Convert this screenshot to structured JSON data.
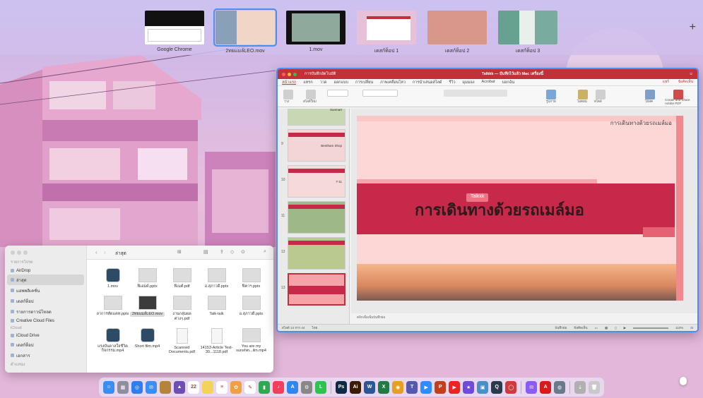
{
  "spaces": [
    {
      "label": "Google Chrome"
    },
    {
      "label": "2ทยแมล์LEO.mov",
      "active": true
    },
    {
      "label": "1.mov"
    },
    {
      "label": "เดสก์ท็อป 1"
    },
    {
      "label": "เดสก์ท็อป 2"
    },
    {
      "label": "เดสก์ท็อป 3"
    }
  ],
  "add_space_label": "+",
  "finder": {
    "path_title": "ล่าสุด",
    "sidebar": [
      {
        "type": "section",
        "label": "รายการโปรด"
      },
      {
        "type": "item",
        "label": "AirDrop"
      },
      {
        "type": "item",
        "label": "ล่าสุด",
        "selected": true
      },
      {
        "type": "item",
        "label": "แอพพลิเคชั่น"
      },
      {
        "type": "item",
        "label": "เดสก์ท็อป"
      },
      {
        "type": "item",
        "label": "รายการดาวน์โหลด"
      },
      {
        "type": "item",
        "label": "Creative Cloud Files"
      },
      {
        "type": "section",
        "label": "iCloud"
      },
      {
        "type": "item",
        "label": "iCloud Drive"
      },
      {
        "type": "item",
        "label": "เดสก์ท็อป"
      },
      {
        "type": "item",
        "label": "เอกสาร"
      },
      {
        "type": "section",
        "label": "ตำแหน่ง"
      },
      {
        "type": "item",
        "label": "เครือข่าย"
      }
    ],
    "files": [
      {
        "name": "1.mov",
        "kind": "video"
      },
      {
        "name": "ฟิเอมด์.pptx",
        "kind": "slide"
      },
      {
        "name": "ฟิเมต์.pdf",
        "kind": "slide"
      },
      {
        "name": "อ.สุภาวดี.pptx",
        "kind": "slide"
      },
      {
        "name": "ฟิคาฯ.pptx",
        "kind": "slide"
      },
      {
        "name": "ลาการทัดแคท.pptx",
        "kind": "slide"
      },
      {
        "name": "2ทยแมล์LEO.mov",
        "kind": "video-thumb",
        "selected": true
      },
      {
        "name": "งานกลุ่มผล ต่างๆ.pdf",
        "kind": "slide"
      },
      {
        "name": "Talk-talk",
        "kind": "slide"
      },
      {
        "name": "อ.สุภาวดี.pptx",
        "kind": "slide"
      },
      {
        "name": "แรงบันดาลใจชีวิต กิจกรรม.mp4",
        "kind": "video"
      },
      {
        "name": "Short film.mp4",
        "kind": "video"
      },
      {
        "name": "Scanned Documents.pdf",
        "kind": "doc"
      },
      {
        "name": "14153-Article Text-30...1118.pdf",
        "kind": "doc"
      },
      {
        "name": "You are my sunshin...ilm.mp4",
        "kind": "slide"
      }
    ]
  },
  "ppt": {
    "window_title": "Talkkk — บันทึกไว้แล้ว Mac เครื่องนี้",
    "autosave_label": "การบันทึกอัตโนมัติ",
    "tabs": [
      "หน้าแรก",
      "แทรก",
      "วาด",
      "ออกแบบ",
      "การเปลี่ยน",
      "ภาพเคลื่อนไหว",
      "การนำเสนอสไลด์",
      "รีวิว",
      "มุมมอง",
      "Acrobat",
      "บอกฉัน"
    ],
    "share_label": "แชร์",
    "comment_label": "ข้อคิดเห็น",
    "ribbon_labels": [
      "วาง",
      "สไลด์ใหม่",
      "รูปภาพ",
      "ไอคอน",
      "สไตล์",
      "ไม้สค",
      "Create and Share Adobe PDF"
    ],
    "thumbnails": [
      {
        "num": "",
        "caption": "Sunmart"
      },
      {
        "num": "9",
        "caption": "Bentham Shop"
      },
      {
        "num": "10",
        "caption": "7-11"
      },
      {
        "num": "11",
        "caption": ""
      },
      {
        "num": "12",
        "caption": ""
      },
      {
        "num": "13",
        "caption": "",
        "selected": true
      }
    ],
    "slide": {
      "corner_title": "การเดินทางด้วยรถเมล์มอ",
      "main_title": "การเดินทางด้วยรถเมล์มอ",
      "tag_label": "Talkkk"
    },
    "notes_placeholder": "คลิกเพื่อเพิ่มบันทึกย่อ",
    "status": {
      "slide_count": "สไลด์ 13 จาก 44",
      "language": "ไทย",
      "notes": "บันทึกย่อ",
      "comments": "ข้อคิดเห็น",
      "zoom": "110%"
    },
    "colors": {
      "accent": "#c2303a",
      "slide_band": "#c7294a"
    }
  },
  "dock": {
    "apps": [
      {
        "name": "finder",
        "color": "#3b8df0",
        "glyph": "☺"
      },
      {
        "name": "launchpad",
        "color": "#8e8e9e",
        "glyph": "▦"
      },
      {
        "name": "safari",
        "color": "#2f7ef0",
        "glyph": "◎"
      },
      {
        "name": "mail",
        "color": "#3a8ef5",
        "glyph": "✉"
      },
      {
        "name": "notes-app",
        "color": "#b5843c",
        "glyph": ""
      },
      {
        "name": "photos-app",
        "color": "#6d4fb3",
        "glyph": "▲"
      },
      {
        "name": "calendar",
        "color": "#ffffff",
        "glyph": "22"
      },
      {
        "name": "notes",
        "color": "#f4d35a",
        "glyph": ""
      },
      {
        "name": "reminders",
        "color": "#ffffff",
        "glyph": "≡"
      },
      {
        "name": "photos",
        "color": "#f0a040",
        "glyph": "✿"
      },
      {
        "name": "freeform",
        "color": "#ffffff",
        "glyph": "✎"
      },
      {
        "name": "numbers",
        "color": "#2fa84f",
        "glyph": "▮"
      },
      {
        "name": "music",
        "color": "#f33d5a",
        "glyph": "♪"
      },
      {
        "name": "app-store",
        "color": "#2f86f0",
        "glyph": "A"
      },
      {
        "name": "settings",
        "color": "#888888",
        "glyph": "⚙"
      },
      {
        "name": "line",
        "color": "#2ec24f",
        "glyph": "L"
      },
      {
        "name": "sep",
        "color": "",
        "glyph": ""
      },
      {
        "name": "photoshop",
        "color": "#0f2a44",
        "glyph": "Ps"
      },
      {
        "name": "illustrator",
        "color": "#3a1c00",
        "glyph": "Ai"
      },
      {
        "name": "word",
        "color": "#2b5797",
        "glyph": "W"
      },
      {
        "name": "excel",
        "color": "#1f7a43",
        "glyph": "X"
      },
      {
        "name": "chrome",
        "color": "#e6a020",
        "glyph": "◉"
      },
      {
        "name": "teams",
        "color": "#5558af",
        "glyph": "T"
      },
      {
        "name": "zoom",
        "color": "#2d8cff",
        "glyph": "▶"
      },
      {
        "name": "powerpoint",
        "color": "#c43e1c",
        "glyph": "P"
      },
      {
        "name": "youtube-app",
        "color": "#e22",
        "glyph": "▶"
      },
      {
        "name": "imovie",
        "color": "#6e4bd8",
        "glyph": "★"
      },
      {
        "name": "preview",
        "color": "#4a90c8",
        "glyph": "▣"
      },
      {
        "name": "quicktime",
        "color": "#2a3a4a",
        "glyph": "Q"
      },
      {
        "name": "photo-booth",
        "color": "#d13a3a",
        "glyph": "◯"
      },
      {
        "name": "sep",
        "color": "",
        "glyph": ""
      },
      {
        "name": "messenger",
        "color": "#8a5cf5",
        "glyph": "✉"
      },
      {
        "name": "acrobat",
        "color": "#d71b1b",
        "glyph": "A"
      },
      {
        "name": "disk-utility",
        "color": "#6a7a8a",
        "glyph": "◍"
      },
      {
        "name": "sep",
        "color": "",
        "glyph": ""
      },
      {
        "name": "downloads-stack",
        "color": "#b0b0b0",
        "glyph": "⇣"
      },
      {
        "name": "trash",
        "color": "#c9c9c9",
        "glyph": "🗑"
      }
    ]
  }
}
